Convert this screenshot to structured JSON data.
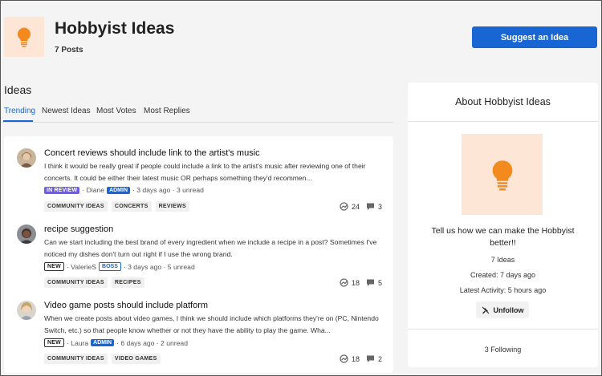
{
  "header": {
    "title": "Hobbyist Ideas",
    "post_count": "7 Posts",
    "suggest_label": "Suggest an Idea",
    "logo_icon": "lightbulb-icon",
    "accent": "#1866d3",
    "logo_color": "#f28a1e"
  },
  "ideas": {
    "heading": "Ideas",
    "tabs": [
      {
        "label": "Trending",
        "active": true
      },
      {
        "label": "Newest Ideas",
        "active": false
      },
      {
        "label": "Most Votes",
        "active": false
      },
      {
        "label": "Most Replies",
        "active": false
      }
    ]
  },
  "posts": [
    {
      "title": "Concert reviews should include link to the artist's music",
      "body": "I think it would be really great if people could include a link to the artist's music after reviewing one of their concerts. It could be either their latest music OR perhaps something they'd recommen...",
      "status": "IN REVIEW",
      "author": "· Diane",
      "role": "ADMIN",
      "time": "· 3 days ago · 3 unread",
      "tags": [
        "COMMUNITY IDEAS",
        "CONCERTS",
        "REVIEWS"
      ],
      "views": "24",
      "replies": "3"
    },
    {
      "title": "recipe suggestion",
      "body": "Can we start including the best brand of every ingredient when we include a recipe in a post? Sometimes I've noticed my dishes don't turn out right if I use the wrong brand.",
      "status": "NEW",
      "author": "· ValerieS",
      "role": "BOSS",
      "time": "· 3 days ago · 5 unread",
      "tags": [
        "COMMUNITY IDEAS",
        "RECIPES"
      ],
      "views": "18",
      "replies": "5"
    },
    {
      "title": "Video game posts should include platform",
      "body": "When we create posts about video games, I think we should include which platforms they're on (PC, Nintendo Switch, etc.) so that people know whether or not they have the ability to play the game. Wha...",
      "status": "NEW",
      "author": "· Laura",
      "role": "ADMIN",
      "time": "· 6 days ago · 2 unread",
      "tags": [
        "COMMUNITY IDEAS",
        "VIDEO GAMES"
      ],
      "views": "18",
      "replies": "2"
    }
  ],
  "about": {
    "heading": "About Hobbyist Ideas",
    "description": "Tell us how we can make the Hobbyist better!!",
    "ideas_count": "7 Ideas",
    "created": "Created: 7 days ago",
    "latest_activity": "Latest Activity: 5 hours ago",
    "unfollow_label": "Unfollow",
    "following": "3 Following"
  }
}
